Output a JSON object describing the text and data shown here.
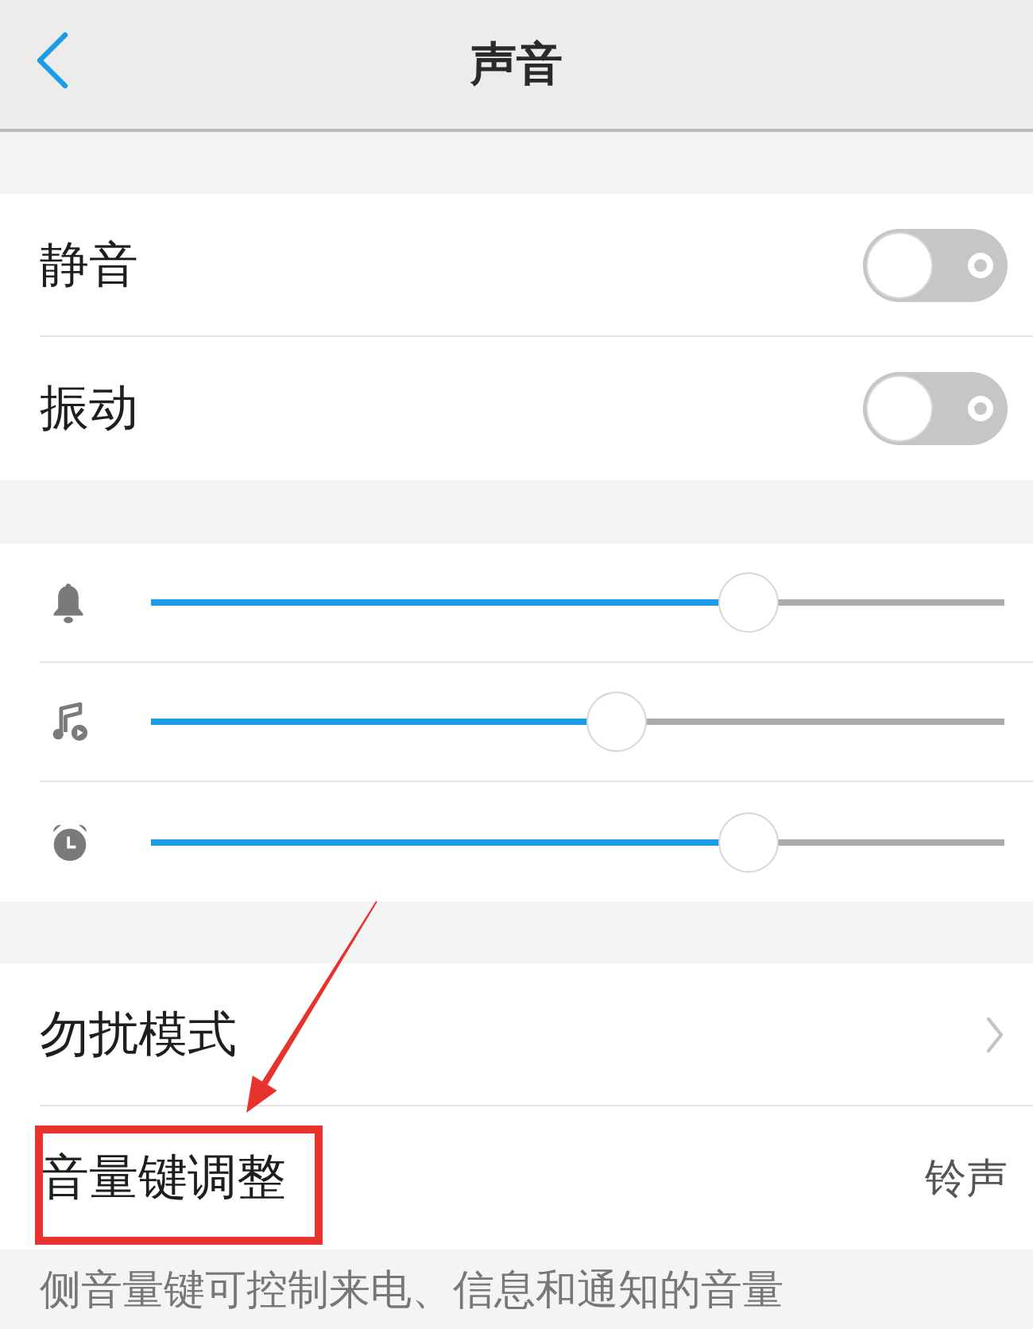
{
  "header": {
    "title": "声音"
  },
  "toggles": [
    {
      "label": "静音",
      "checked": false
    },
    {
      "label": "振动",
      "checked": false
    }
  ],
  "volume_sliders": [
    {
      "level": 0.7
    },
    {
      "level": 0.545
    },
    {
      "level": 0.7
    }
  ],
  "settings": [
    {
      "kind": "link",
      "label": "勿扰模式"
    },
    {
      "kind": "value",
      "label": "音量键调整",
      "value": "铃声"
    }
  ],
  "footnote": "侧音量键可控制来电、信息和通知的音量"
}
